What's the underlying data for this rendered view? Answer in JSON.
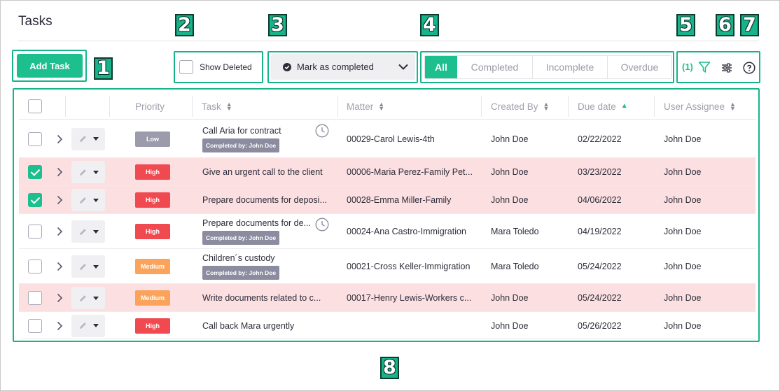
{
  "page": {
    "title": "Tasks"
  },
  "toolbar": {
    "add_task_label": "Add Task",
    "show_deleted_label": "Show Deleted",
    "mark_completed_label": "Mark as completed",
    "status_filter": [
      {
        "label": "All",
        "active": true
      },
      {
        "label": "Completed",
        "active": false
      },
      {
        "label": "Incomplete",
        "active": false
      },
      {
        "label": "Overdue",
        "active": false
      }
    ],
    "filter_count": "(1)",
    "icons": {
      "filter": "filter-icon",
      "columns": "sliders-icon",
      "help": "help-icon"
    }
  },
  "callouts": [
    "1",
    "2",
    "3",
    "4",
    "5",
    "6",
    "7",
    "8"
  ],
  "table": {
    "headers": {
      "priority": "Priority",
      "task": "Task",
      "matter": "Matter",
      "created_by": "Created By",
      "due_date": "Due date",
      "user_assignee": "User Assignee"
    },
    "sorted_column": "due_date",
    "rows": [
      {
        "checked": false,
        "highlight": false,
        "priority": "Low",
        "priority_level": "low",
        "task": "Call Aria for contract",
        "completed_by": "Completed by: John Doe",
        "clock": true,
        "matter": "00029-Carol Lewis-4th",
        "created_by": "John Doe",
        "due_date": "02/22/2022",
        "assignee": "John Doe"
      },
      {
        "checked": true,
        "highlight": true,
        "priority": "High",
        "priority_level": "high",
        "task": "Give an urgent call to the client",
        "completed_by": "",
        "clock": false,
        "matter": "00006-Maria Perez-Family Pet...",
        "created_by": "John Doe",
        "due_date": "03/23/2022",
        "assignee": "John Doe"
      },
      {
        "checked": true,
        "highlight": true,
        "priority": "High",
        "priority_level": "high",
        "task": "Prepare documents for deposi...",
        "completed_by": "",
        "clock": false,
        "matter": "00028-Emma Miller-Family",
        "created_by": "John Doe",
        "due_date": "04/06/2022",
        "assignee": "John Doe"
      },
      {
        "checked": false,
        "highlight": false,
        "priority": "High",
        "priority_level": "high",
        "task": "Prepare documents for de...",
        "completed_by": "Completed by: John Doe",
        "clock": true,
        "matter": "00024-Ana Castro-Immigration",
        "created_by": "Mara Toledo",
        "due_date": "04/19/2022",
        "assignee": "John Doe"
      },
      {
        "checked": false,
        "highlight": false,
        "priority": "Medium",
        "priority_level": "medium",
        "task": "Children´s custody",
        "completed_by": "Completed by: John Doe",
        "clock": false,
        "matter": "00021-Cross Keller-Immigration",
        "created_by": "Mara Toledo",
        "due_date": "05/24/2022",
        "assignee": "John Doe"
      },
      {
        "checked": false,
        "highlight": true,
        "priority": "Medium",
        "priority_level": "medium",
        "task": "Write documents related to c...",
        "completed_by": "",
        "clock": false,
        "matter": "00017-Henry Lewis-Workers c...",
        "created_by": "John Doe",
        "due_date": "05/24/2022",
        "assignee": "John Doe"
      },
      {
        "checked": false,
        "highlight": false,
        "priority": "High",
        "priority_level": "high",
        "task": "Call back Mara urgently",
        "completed_by": "",
        "clock": false,
        "matter": "",
        "created_by": "John Doe",
        "due_date": "05/26/2022",
        "assignee": "John Doe"
      }
    ]
  },
  "colors": {
    "accent": "#1dbf8e",
    "callout": "#17b48c",
    "highlight_row": "#fcdfe1",
    "priority_low": "#9b9bab",
    "priority_high": "#f04a50",
    "priority_medium": "#fba35a"
  }
}
